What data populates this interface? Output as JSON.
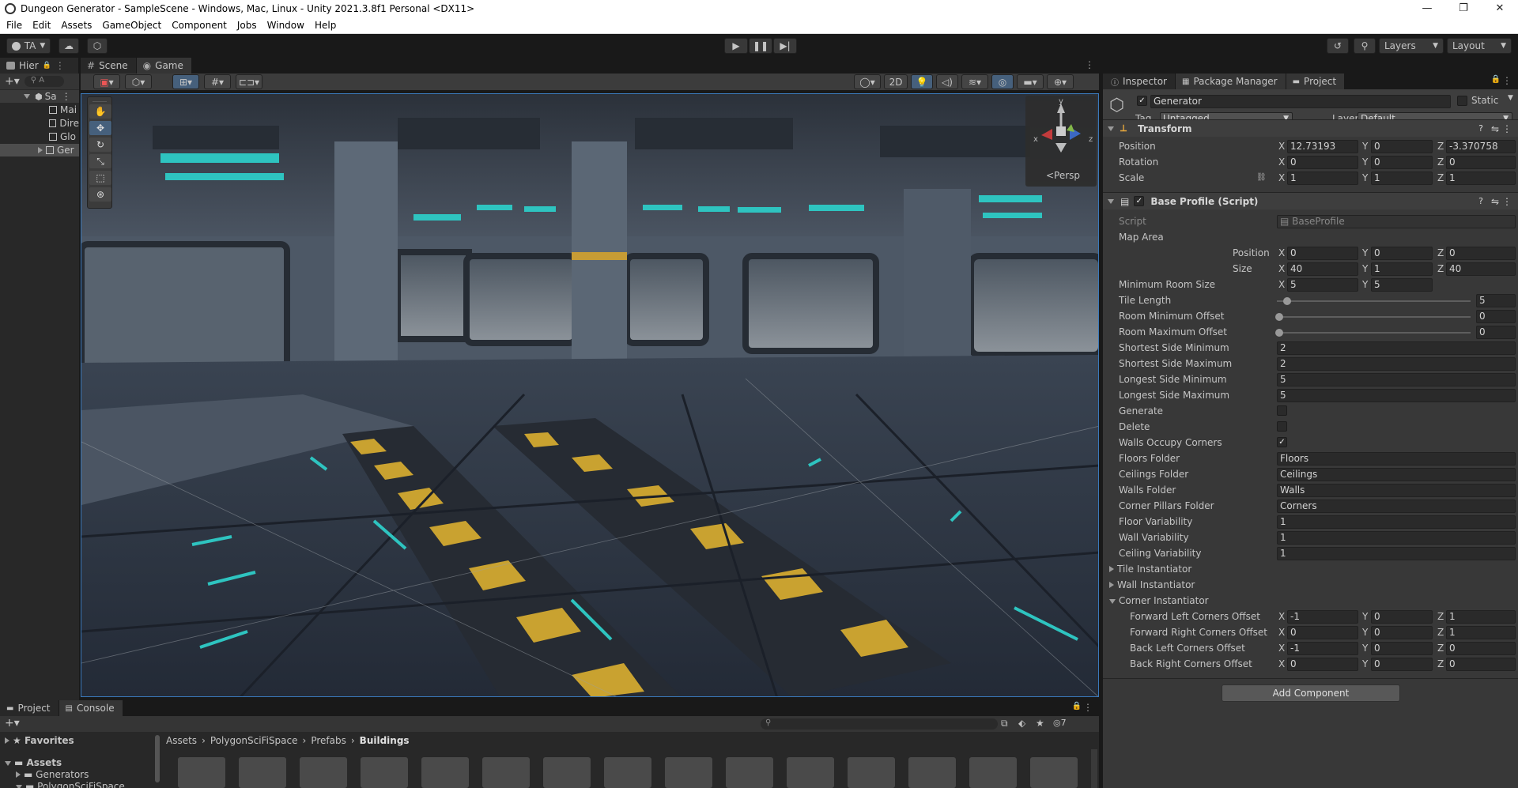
{
  "window": {
    "title": "Dungeon Generator - SampleScene - Windows, Mac, Linux - Unity 2021.3.8f1 Personal <DX11>",
    "minimize": "—",
    "maximize": "❐",
    "close": "✕"
  },
  "menu": [
    "File",
    "Edit",
    "Assets",
    "GameObject",
    "Component",
    "Jobs",
    "Window",
    "Help"
  ],
  "toolbar": {
    "account": "TA",
    "layers": "Layers",
    "layout": "Layout"
  },
  "hierarchy": {
    "tab": "Hier",
    "search_placeholder": "A",
    "scene": "Sa",
    "items": [
      "Mai",
      "Dire",
      "Glo",
      "Ger"
    ]
  },
  "scene_tabs": [
    "Scene",
    "Game"
  ],
  "scene_toolbar": {
    "mode_2d": "2D"
  },
  "gizmo": {
    "label": "<Persp",
    "y": "y",
    "x": "x",
    "z": "z"
  },
  "inspector": {
    "tabs": [
      "Inspector",
      "Package Manager",
      "Project"
    ],
    "object_name": "Generator",
    "static_label": "Static",
    "tag_label": "Tag",
    "tag_value": "Untagged",
    "layer_label": "Layer",
    "layer_value": "Default",
    "transform": {
      "title": "Transform",
      "position_label": "Position",
      "rotation_label": "Rotation",
      "scale_label": "Scale",
      "position": [
        "12.73193",
        "0",
        "-3.370758"
      ],
      "rotation": [
        "0",
        "0",
        "0"
      ],
      "scale": [
        "1",
        "1",
        "1"
      ]
    },
    "script_comp": {
      "title": "Base Profile (Script)",
      "script_label": "Script",
      "script_value": "BaseProfile",
      "map_area_label": "Map Area",
      "map_position_label": "Position",
      "map_size_label": "Size",
      "map_position": [
        "0",
        "0",
        "0"
      ],
      "map_size": [
        "40",
        "1",
        "40"
      ],
      "min_room_label": "Minimum Room Size",
      "min_room": [
        "5",
        "5"
      ],
      "tile_length_label": "Tile Length",
      "tile_length": "5",
      "room_min_offset_label": "Room Minimum Offset",
      "room_min_offset": "0",
      "room_max_offset_label": "Room Maximum Offset",
      "room_max_offset": "0",
      "fields": [
        {
          "label": "Shortest Side Minimum",
          "value": "2"
        },
        {
          "label": "Shortest Side Maximum",
          "value": "2"
        },
        {
          "label": "Longest Side Minimum",
          "value": "5"
        },
        {
          "label": "Longest Side Maximum",
          "value": "5"
        }
      ],
      "generate_label": "Generate",
      "delete_label": "Delete",
      "walls_corners_label": "Walls Occupy Corners",
      "folders": [
        {
          "label": "Floors Folder",
          "value": "Floors"
        },
        {
          "label": "Ceilings Folder",
          "value": "Ceilings"
        },
        {
          "label": "Walls Folder",
          "value": "Walls"
        },
        {
          "label": "Corner Pillars Folder",
          "value": "Corners"
        },
        {
          "label": "Floor Variability",
          "value": "1"
        },
        {
          "label": "Wall Variability",
          "value": "1"
        },
        {
          "label": "Ceiling Variability",
          "value": "1"
        }
      ],
      "tile_instantiator": "Tile Instantiator",
      "wall_instantiator": "Wall Instantiator",
      "corner_instantiator": "Corner Instantiator",
      "corner_offsets": [
        {
          "label": "Forward Left Corners Offset",
          "values": [
            "-1",
            "0",
            "1"
          ]
        },
        {
          "label": "Forward Right Corners Offset",
          "values": [
            "0",
            "0",
            "1"
          ]
        },
        {
          "label": "Back Left Corners Offset",
          "values": [
            "-1",
            "0",
            "0"
          ]
        },
        {
          "label": "Back Right Corners Offset",
          "values": [
            "0",
            "0",
            "0"
          ]
        }
      ]
    },
    "add_component": "Add Component"
  },
  "project": {
    "tabs": [
      "Project",
      "Console"
    ],
    "favorites": "Favorites",
    "assets": "Assets",
    "folders": [
      "Generators",
      "PolygonSciFiSpace"
    ],
    "breadcrumb": [
      "Assets",
      "PolygonSciFiSpace",
      "Prefabs",
      "Buildings"
    ],
    "hidden_count": "7"
  },
  "colors": {
    "accent_blue": "#3a79bb",
    "teal_light": "#2ec4c0",
    "hazard_yellow": "#c9a230"
  }
}
